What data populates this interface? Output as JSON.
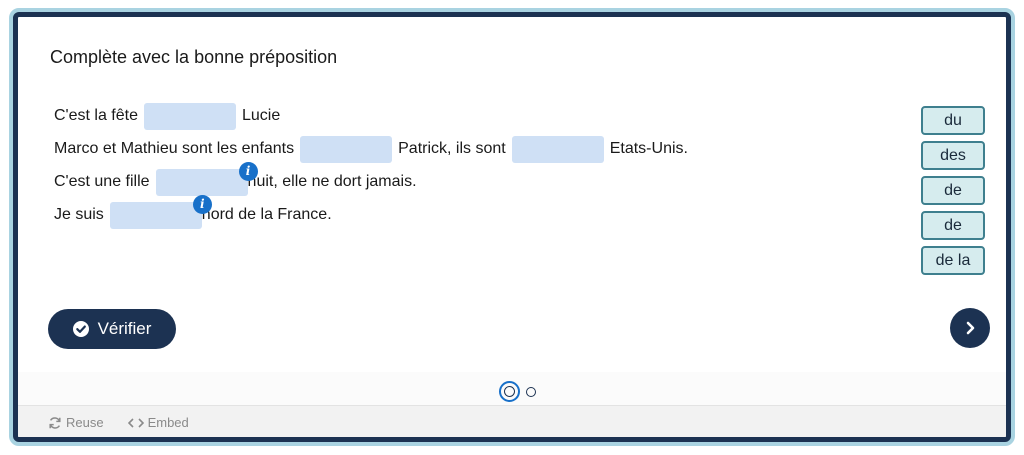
{
  "exercise": {
    "title": "Complète avec la bonne préposition",
    "sentences": [
      {
        "parts": [
          "C'est la fête",
          "Lucie"
        ]
      },
      {
        "parts": [
          "Marco et Mathieu sont les enfants",
          "Patrick, ils sont",
          "Etats-Unis."
        ]
      },
      {
        "parts": [
          "C'est une fille",
          "nuit, elle ne dort jamais."
        ]
      },
      {
        "parts": [
          "Je suis",
          "nord de la France."
        ]
      }
    ],
    "info_badge_glyph": "i"
  },
  "word_bank": [
    "du",
    "des",
    "de",
    "de",
    "de la"
  ],
  "actions": {
    "check_label": "Vérifier"
  },
  "pagination": {
    "current": 1,
    "total": 2
  },
  "footer": {
    "reuse_label": "Reuse",
    "embed_label": "Embed"
  },
  "colors": {
    "primary": "#1c3252",
    "frame": "#a9d3e1",
    "blank": "#cfe0f5",
    "chip_bg": "#d6ecee",
    "chip_border": "#3e7f8e",
    "info": "#1870c9"
  },
  "icons": {
    "check": "check-circle-icon",
    "next": "chevron-right-icon",
    "reuse": "refresh-icon",
    "embed": "code-icon",
    "info": "info-icon"
  }
}
